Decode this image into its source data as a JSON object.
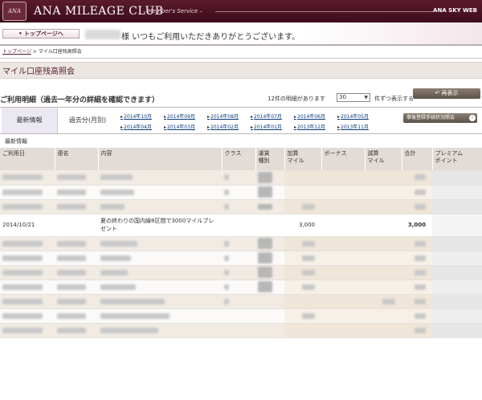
{
  "header": {
    "logo_badge": "ANA",
    "brand": "ANA MILEAGE CLUB",
    "brand_sub": "– Member's Service –",
    "site_name": "ANA SKY WEB"
  },
  "nav": {
    "top_page_button": "• トップページへ"
  },
  "greeting": {
    "text": "様 いつもご利用いただきありがとうございます。"
  },
  "breadcrumb": {
    "top": "トップページ",
    "separator": ">",
    "current": "マイル口座残高照会"
  },
  "page_title": "マイル口座残高照会",
  "section": {
    "title": "ご利用明細（過去一年分の詳細を確認できます）",
    "count_text": "12件の明細があります",
    "per_page_value": "30",
    "per_page_suffix": "件ずつ表示する",
    "show_button": "↶ 再表示"
  },
  "tabs": {
    "latest": "最新情報",
    "past": "過去分(月別)",
    "months": [
      "2014年10月",
      "2014年09月",
      "2014年08月",
      "2014年07月",
      "2014年06月",
      "2014年05月",
      "2014年04月",
      "2014年03月",
      "2014年02月",
      "2014年01月",
      "2013年12月",
      "2013年11月"
    ],
    "status_button": "事後登録手続状況照会"
  },
  "subhead": "最新情報",
  "table": {
    "headers": {
      "date": "ご利用日",
      "flight": "便名",
      "content": "内容",
      "class": "クラス",
      "fare": "運賃\n種別",
      "add_miles": "加算\nマイル",
      "bonus": "ボーナス",
      "sub_miles": "減算\nマイル",
      "total": "合計",
      "premium": "プレミアム\nポイント"
    },
    "visible_row": {
      "date": "2014/10/21",
      "content": "夏の終わりの国内線8区間で3000マイルプレゼント",
      "add_miles": "3,000",
      "total": "3,000"
    }
  }
}
